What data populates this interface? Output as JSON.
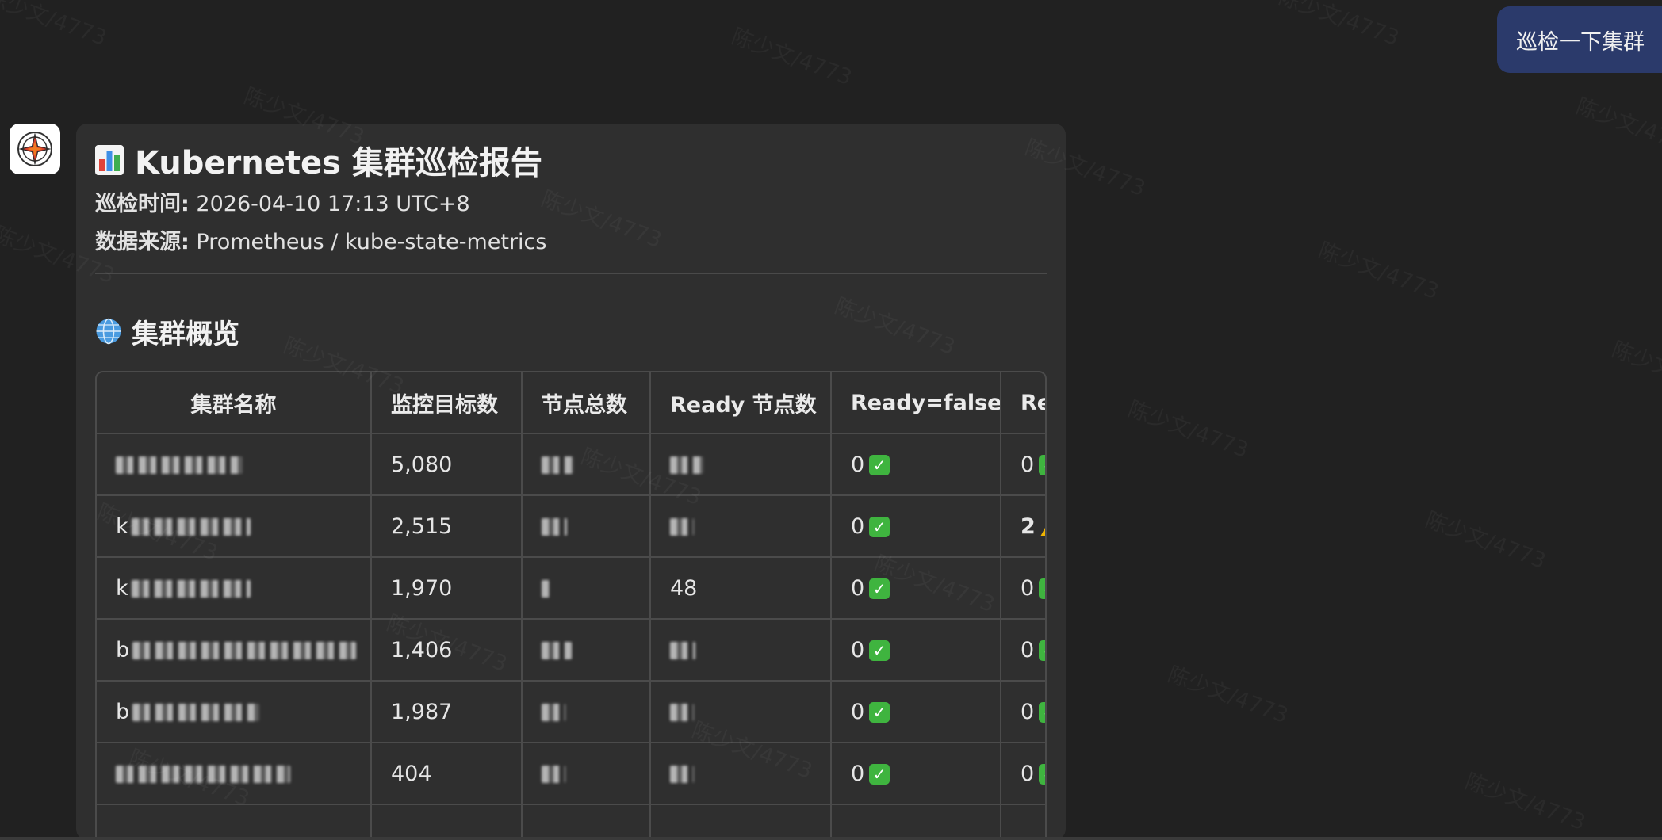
{
  "user_message": {
    "text": "巡检一下集群"
  },
  "report": {
    "title_icon": "bar-chart-icon",
    "title": "Kubernetes 集群巡检报告",
    "inspection_time": {
      "label": "巡检时间:",
      "value": "2026-04-10 17:13 UTC+8"
    },
    "data_source": {
      "label": "数据来源:",
      "value": "Prometheus / kube-state-metrics"
    },
    "overview_section": {
      "icon": "globe-icon",
      "title": "集群概览",
      "columns": [
        "集群名称",
        "监控目标数",
        "节点总数",
        "Ready 节点数",
        "Ready=false",
        "Re"
      ],
      "rows": [
        {
          "cluster": "",
          "targets": "5,080",
          "nodes": "",
          "ready": "",
          "not_ready": "0",
          "next": "0",
          "next_warn": false
        },
        {
          "cluster": "k",
          "targets": "2,515",
          "nodes": "",
          "ready": "",
          "not_ready": "0",
          "next": "2",
          "next_warn": true
        },
        {
          "cluster": "k",
          "targets": "1,970",
          "nodes": "",
          "ready": "48",
          "not_ready": "0",
          "next": "0",
          "next_warn": false
        },
        {
          "cluster": "b",
          "targets": "1,406",
          "nodes": "",
          "ready": "",
          "not_ready": "0",
          "next": "0",
          "next_warn": false
        },
        {
          "cluster": "b",
          "targets": "1,987",
          "nodes": "",
          "ready": "",
          "not_ready": "0",
          "next": "0",
          "next_warn": false
        },
        {
          "cluster": "",
          "targets": "404",
          "nodes": "",
          "ready": "",
          "not_ready": "0",
          "next": "0",
          "next_warn": false
        }
      ]
    }
  },
  "watermark": "陈少文/4773",
  "colors": {
    "background": "#212121",
    "card": "#2f2f2f",
    "user_bubble": "#2b3a6b",
    "ok_green": "#3fb43f",
    "warn_yellow": "#f0b400"
  }
}
